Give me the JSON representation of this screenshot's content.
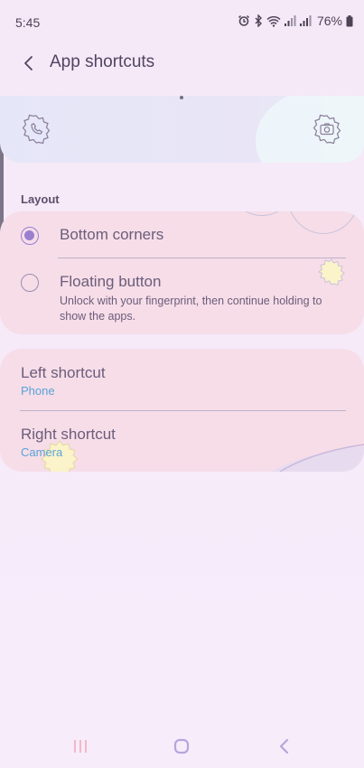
{
  "status_bar": {
    "time": "5:45",
    "battery": "76%"
  },
  "header": {
    "title": "App shortcuts"
  },
  "layout_section": {
    "title": "Layout",
    "options": [
      {
        "label": "Bottom corners",
        "selected": true
      },
      {
        "label": "Floating button",
        "selected": false,
        "description": "Unlock with your fingerprint, then continue holding to show the apps."
      }
    ]
  },
  "shortcuts": {
    "left": {
      "title": "Left shortcut",
      "value": "Phone"
    },
    "right": {
      "title": "Right shortcut",
      "value": "Camera"
    }
  },
  "colors": {
    "accent": "#9a7fd0",
    "summary": "#5aa2d8",
    "card": "#f6dde8",
    "background": "#f6eaf9"
  },
  "icons": [
    "alarm-icon",
    "bluetooth-icon",
    "wifi-icon",
    "signal-icon",
    "battery-icon",
    "back-arrow-icon",
    "phone-icon",
    "camera-icon",
    "recents-icon",
    "home-icon",
    "nav-back-icon"
  ]
}
